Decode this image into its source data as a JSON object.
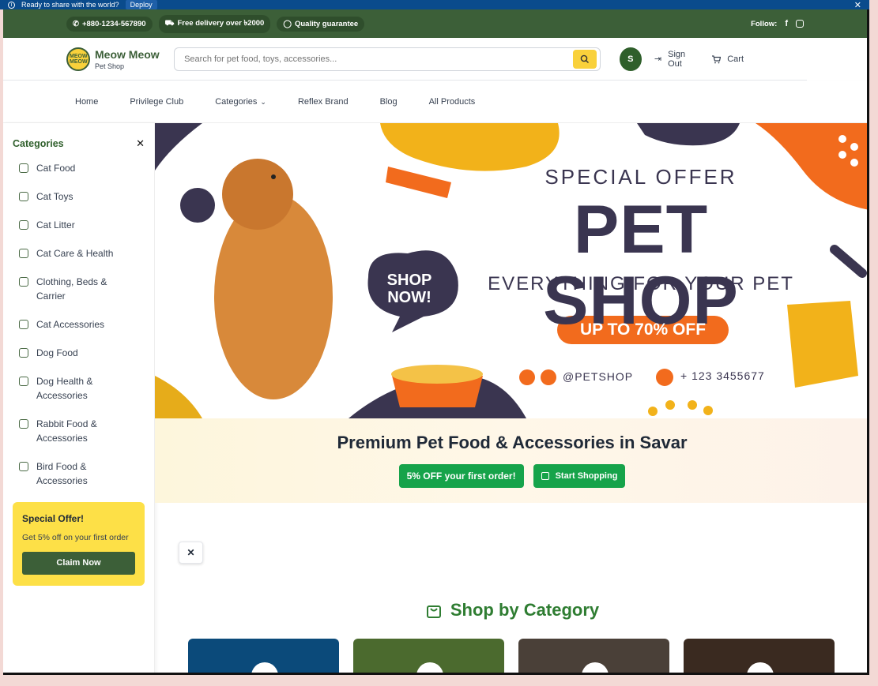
{
  "deploy_bar": {
    "message": "Ready to share with the world?",
    "deploy_label": "Deploy"
  },
  "topbar": {
    "phone": "+880-1234-567890",
    "delivery": "Free delivery over ৳2000",
    "quality": "Quality guarantee",
    "follow": "Follow:"
  },
  "header": {
    "brand_name": "Meow Meow",
    "brand_sub": "Pet Shop",
    "logo_text": "MEOW MEOW",
    "search_placeholder": "Search for pet food, toys, accessories...",
    "avatar_initial": "S",
    "sign_out": "Sign Out",
    "cart": "Cart"
  },
  "nav": {
    "items": [
      "Home",
      "Privilege Club",
      "Categories",
      "Reflex Brand",
      "Blog",
      "All Products"
    ]
  },
  "sidebar": {
    "title": "Categories",
    "items": [
      {
        "label": "Cat Food",
        "icon": "crown-icon"
      },
      {
        "label": "Cat Toys",
        "icon": "gamepad-icon"
      },
      {
        "label": "Cat Litter",
        "icon": "box-icon"
      },
      {
        "label": "Cat Care & Health",
        "icon": "hand-heart-icon"
      },
      {
        "label": "Clothing, Beds & Carrier",
        "icon": "shirt-icon"
      },
      {
        "label": "Cat Accessories",
        "icon": "gem-icon"
      },
      {
        "label": "Dog Food",
        "icon": "dog-icon"
      },
      {
        "label": "Dog Health & Accessories",
        "icon": "plus-icon"
      },
      {
        "label": "Rabbit Food & Accessories",
        "icon": "carrot-icon"
      },
      {
        "label": "Bird Food & Accessories",
        "icon": "bird-icon"
      }
    ],
    "offer": {
      "title": "Special Offer!",
      "desc": "Get 5% off on your first order",
      "button": "Claim Now"
    }
  },
  "hero": {
    "special_offer": "SPECIAL OFFER",
    "headline": "PET SHOP",
    "tagline": "EVERYTHING FOR YOUR PET",
    "discount": "UP TO 70% OFF",
    "bubble": "SHOP NOW!",
    "handle": "@PETSHOP",
    "phone": "+ 123 3455677"
  },
  "banner": {
    "heading": "Premium Pet Food & Accessories in Savar",
    "first_order": "5% OFF your first order!",
    "start_shopping": "Start Shopping"
  },
  "shop_by_category": {
    "title": "Shop by Category"
  },
  "colors": {
    "brand_green": "#3c5f38",
    "cta_green": "#16a34a",
    "accent_yellow": "#f9d13b",
    "hero_orange": "#f26b1d",
    "hero_navy": "#3a3550"
  }
}
